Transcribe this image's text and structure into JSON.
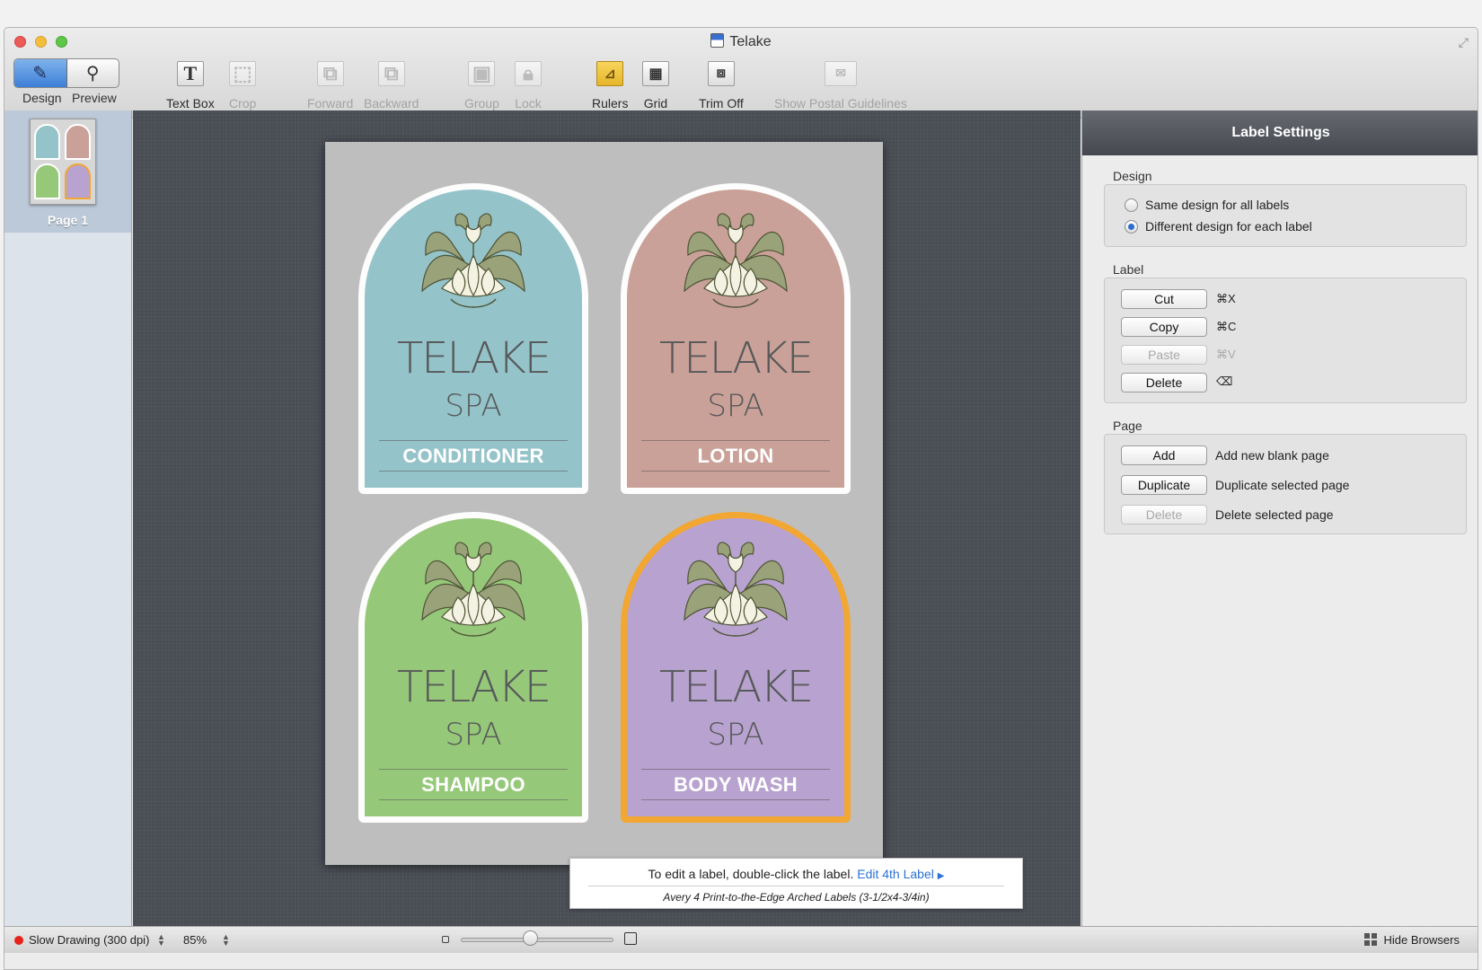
{
  "window": {
    "title": "Telake"
  },
  "toolbar": {
    "design_label": "Design",
    "preview_label": "Preview",
    "textbox_label": "Text Box",
    "crop_label": "Crop",
    "forward_label": "Forward",
    "backward_label": "Backward",
    "group_label": "Group",
    "lock_label": "Lock",
    "rulers_label": "Rulers",
    "grid_label": "Grid",
    "trimoff_label": "Trim Off",
    "postal_label": "Show Postal Guidelines"
  },
  "browser": {
    "page_label": "Page 1"
  },
  "labels": [
    {
      "brand": "TELAKE",
      "sub": "SPA",
      "product": "CONDITIONER",
      "color": "#94c3c9"
    },
    {
      "brand": "TELAKE",
      "sub": "SPA",
      "product": "LOTION",
      "color": "#caa198"
    },
    {
      "brand": "TELAKE",
      "sub": "SPA",
      "product": "SHAMPOO",
      "color": "#96c87a"
    },
    {
      "brand": "TELAKE",
      "sub": "SPA",
      "product": "BODY WASH",
      "color": "#b8a2cf",
      "selected": true
    }
  ],
  "hint": {
    "text": "To edit a label, double-click the label.",
    "link": "Edit 4th Label",
    "template": "Avery 4 Print-to-the-Edge Arched Labels (3-1/2x4-3/4in)"
  },
  "inspector": {
    "title": "Label Settings",
    "design": {
      "title": "Design",
      "option_same": "Same design for all labels",
      "option_different": "Different design for each label"
    },
    "label": {
      "title": "Label",
      "cut": "Cut",
      "cut_sc": "⌘X",
      "copy": "Copy",
      "copy_sc": "⌘C",
      "paste": "Paste",
      "paste_sc": "⌘V",
      "delete": "Delete",
      "delete_sc": "⌫"
    },
    "page": {
      "title": "Page",
      "add": "Add",
      "add_desc": "Add new blank page",
      "duplicate": "Duplicate",
      "duplicate_desc": "Duplicate selected page",
      "delete": "Delete",
      "delete_desc": "Delete selected page"
    }
  },
  "status": {
    "quality": "Slow Drawing (300 dpi)",
    "zoom": "85%",
    "hide_browsers": "Hide Browsers"
  }
}
